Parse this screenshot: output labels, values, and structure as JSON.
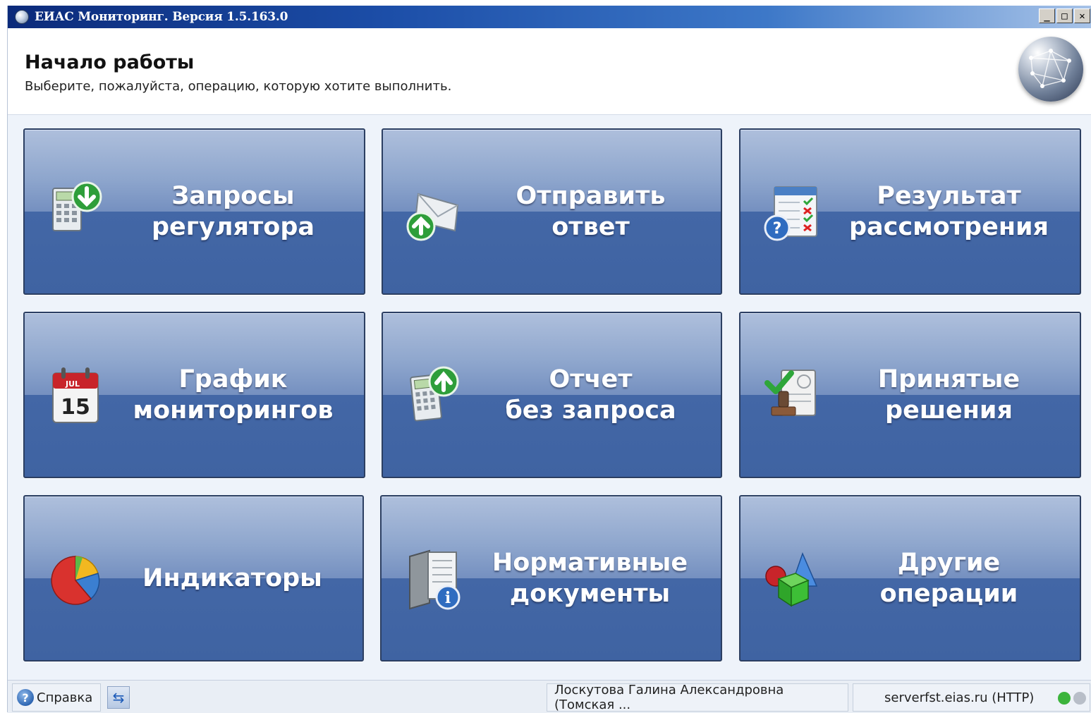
{
  "window": {
    "title": "ЕИАС Мониторинг. Версия 1.5.163.0",
    "controls": {
      "minimize": "_",
      "maximize": "□",
      "close": "✕"
    }
  },
  "header": {
    "title": "Начало работы",
    "subtitle": "Выберите, пожалуйста, операцию, которую хотите выполнить."
  },
  "tiles": [
    {
      "label": "Запросы\nрегулятора",
      "icon": "calculator-download-icon"
    },
    {
      "label": "Отправить\nответ",
      "icon": "envelope-upload-icon"
    },
    {
      "label": "Результат\nрассмотрения",
      "icon": "checklist-question-icon"
    },
    {
      "label": "График\nмониторингов",
      "icon": "calendar-icon",
      "icon_text": "15",
      "icon_month": "JUL"
    },
    {
      "label": "Отчет\nбез запроса",
      "icon": "calculator-upload-icon"
    },
    {
      "label": "Принятые\nрешения",
      "icon": "stamp-approved-icon"
    },
    {
      "label": "Индикаторы",
      "icon": "pie-chart-icon"
    },
    {
      "label": "Нормативные\nдокументы",
      "icon": "documents-info-icon"
    },
    {
      "label": "Другие\nоперации",
      "icon": "shapes-icon"
    }
  ],
  "statusbar": {
    "help_label": "Справка",
    "user": "Лоскутова Галина Александровна (Томская ...",
    "server": "serverfst.eias.ru (HTTP)",
    "connection_colors": [
      "#3cb43c",
      "#b8bec8"
    ]
  }
}
